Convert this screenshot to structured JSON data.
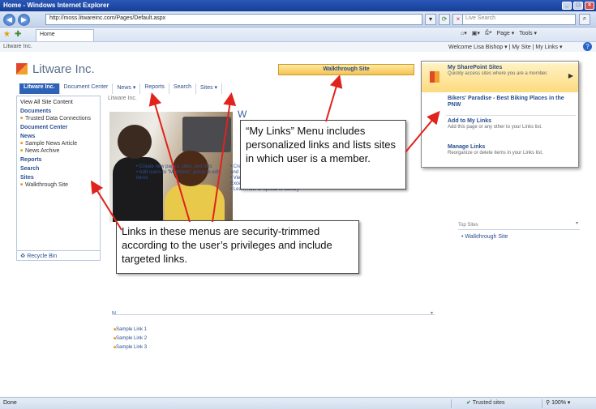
{
  "browser": {
    "title": "Home - Windows Internet Explorer",
    "url": "http://moss.litwareinc.com/Pages/Default.aspx",
    "search_placeholder": "Live Search",
    "tab_label": "Home",
    "toolbar_items": [
      "Page ▾",
      "Tools ▾"
    ],
    "status_left": "Done",
    "zone": "Trusted sites",
    "zoom": "100%"
  },
  "sharepoint": {
    "top_label": "Litware Inc.",
    "welcome": "Welcome Lisa Bishop ▾ | My Site | My Links ▾",
    "site_name": "Litware Inc.",
    "topnav": [
      "Litware Inc.",
      "Document Center",
      "News ▾",
      "Reports",
      "Search",
      "Sites ▾"
    ],
    "breadcrumb": "Litware Inc.",
    "welcome_title": "W",
    "quicklaunch": {
      "view_all": "View All Site Content",
      "documents": "Documents",
      "doc_item": "Trusted Data Connections",
      "document_center": "Document Center",
      "news": "News",
      "news_item1": "Sample News Article",
      "news_item2": "News Archive",
      "reports": "Reports",
      "search": "Search",
      "sites": "Sites",
      "sites_item": "Walkthrough Site",
      "recycle": "Recycle Bin"
    },
    "getting_started_tail": "ress",
    "gs_col1": "• Create new pages, sites, and lists\n• Add users to \"Members\" group to edit items",
    "gs_col2": "• Create key performance indicators and reports\n• View and edit workbook through the Excel Web Access Web Part\n• Learn how to upload to Library",
    "links_header": "N",
    "links_menu": "▾",
    "links": [
      "Sample Link 1",
      "Sample Link 2",
      "Sample Link 3"
    ],
    "top_sites_header": "Top Sites",
    "top_sites_menu": "▾",
    "top_sites_item": "• Walkthrough Site"
  },
  "menu": {
    "walkthrough": "Walkthrough Site",
    "items": [
      {
        "title": "My SharePoint Sites",
        "desc": "Quickly access sites where you are a member."
      },
      {
        "title": "Bikers' Paradise - Best Biking Places in the PNW",
        "desc": ""
      },
      {
        "title": "Add to My Links",
        "desc": "Add this page or any other to your Links list."
      },
      {
        "title": "Manage Links",
        "desc": "Reorganize or delete items in your Links list."
      }
    ]
  },
  "annotations": {
    "mylinks": "“My Links” Menu includes personalized links and lists sites in which user is a member.",
    "trimmed": "Links in these menus are security-trimmed according to the user’s privileges and include targeted links."
  },
  "colors": {
    "accent": "#2e62b7",
    "annotation_arrow": "#e0231c",
    "menu_highlight": "#fcdb7f"
  }
}
